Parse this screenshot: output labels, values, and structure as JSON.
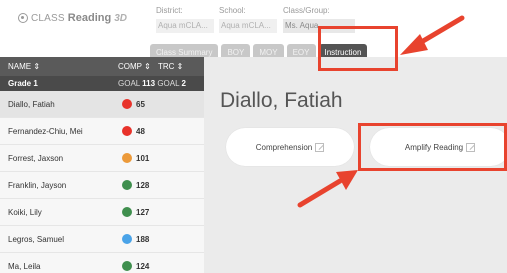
{
  "header": {
    "logo": {
      "class_text": "CLASS",
      "reading_text": "Reading",
      "suffix": "3D"
    },
    "filters": [
      {
        "label": "District:",
        "value": "Aqua mCLA..."
      },
      {
        "label": "School:",
        "value": "Aqua mCLA..."
      },
      {
        "label": "Class/Group:",
        "value": "Ms. Aqua..."
      }
    ]
  },
  "tabs": [
    {
      "label": "Class Summary",
      "active": false
    },
    {
      "label": "BOY",
      "active": false
    },
    {
      "label": "MOY",
      "active": false
    },
    {
      "label": "EOY",
      "active": false
    },
    {
      "label": "Instruction",
      "active": true
    }
  ],
  "sidebar": {
    "headers": {
      "name": "NAME ⇕",
      "comp": "COMP ⇕",
      "trc": "TRC ⇕"
    },
    "grade": {
      "label": "Grade 1",
      "goal_label_1": "GOAL",
      "goal_1": "113",
      "goal_label_2": "GOAL",
      "goal_2": "2"
    },
    "students": [
      {
        "name": "Diallo, Fatiah",
        "score": "65",
        "color": "#e8322a",
        "active": true
      },
      {
        "name": "Fernandez-Chiu, Mei",
        "score": "48",
        "color": "#e8322a",
        "active": false
      },
      {
        "name": "Forrest, Jaxson",
        "score": "101",
        "color": "#ec9a3a",
        "active": false
      },
      {
        "name": "Franklin, Jayson",
        "score": "128",
        "color": "#3f8f4e",
        "active": false
      },
      {
        "name": "Koiki, Lily",
        "score": "127",
        "color": "#3f8f4e",
        "active": false
      },
      {
        "name": "Legros, Samuel",
        "score": "188",
        "color": "#4aa3e8",
        "active": false
      },
      {
        "name": "Ma, Leila",
        "score": "124",
        "color": "#3f8f4e",
        "active": false
      }
    ]
  },
  "main": {
    "student_title": "Diallo, Fatiah",
    "buttons": {
      "comprehension": "Comprehension",
      "amplify": "Amplify Reading"
    }
  },
  "colors": {
    "annotation": "#e8432e",
    "active_tab": "#545454",
    "header_bar": "#5a5a5a"
  }
}
